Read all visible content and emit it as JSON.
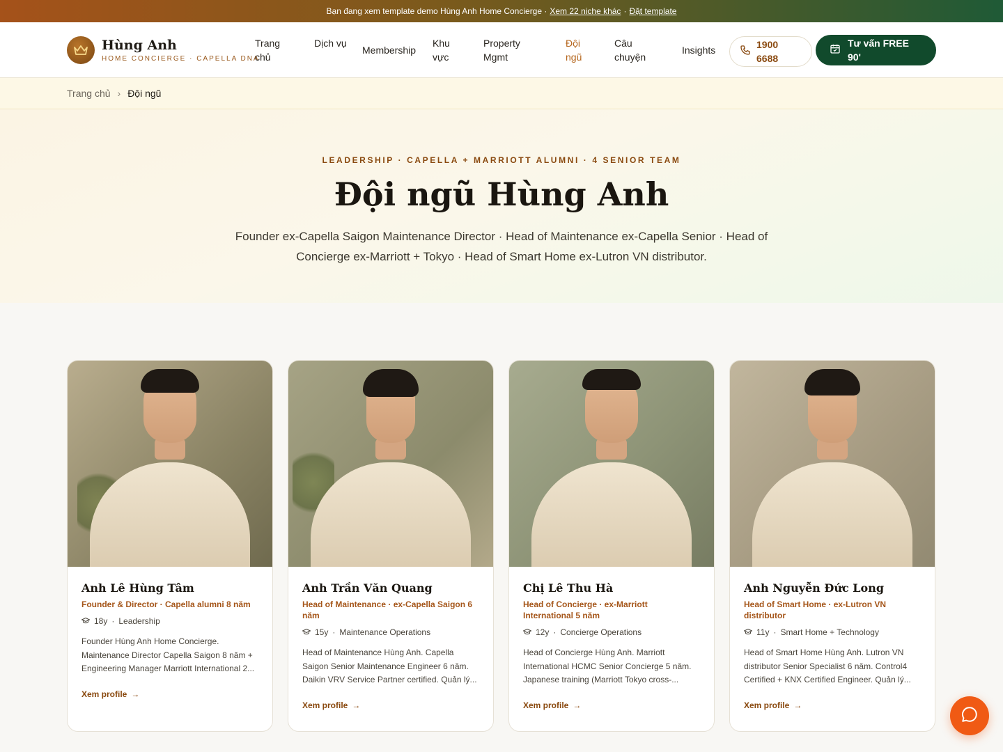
{
  "banner": {
    "text": "Bạn đang xem template demo Hùng Anh Home Concierge ·",
    "link_more": "Xem 22 niche khác",
    "separator": "·",
    "link_order": "Đặt template"
  },
  "header": {
    "logo_name": "Hùng Anh",
    "logo_tagline": "HOME CONCIERGE · CAPELLA DNA",
    "nav": [
      {
        "label": "Trang chủ"
      },
      {
        "label": "Dịch vụ"
      },
      {
        "label": "Membership"
      },
      {
        "label": "Khu vực"
      },
      {
        "label": "Property Mgmt"
      },
      {
        "label": "Đội ngũ",
        "active": true
      },
      {
        "label": "Câu chuyện"
      },
      {
        "label": "Insights"
      }
    ],
    "phone": "1900 6688",
    "cta": "Tư vấn FREE 90'"
  },
  "breadcrumb": {
    "home": "Trang chủ",
    "separator": "›",
    "current": "Đội ngũ"
  },
  "hero": {
    "eyebrow": "LEADERSHIP · CAPELLA + MARRIOTT ALUMNI · 4 SENIOR TEAM",
    "title": "Đội ngũ Hùng Anh",
    "subtitle": "Founder ex-Capella Saigon Maintenance Director · Head of Maintenance ex-Capella Senior · Head of Concierge ex-Marriott + Tokyo · Head of Smart Home ex-Lutron VN distributor."
  },
  "team": [
    {
      "name": "Anh Lê Hùng Tâm",
      "role": "Founder & Director · Capella alumni 8 năm",
      "years": "18y",
      "area": "Leadership",
      "desc": "Founder Hùng Anh Home Concierge. Maintenance Director Capella Saigon 8 năm + Engineering Manager Marriott International 2...",
      "link": "Xem profile"
    },
    {
      "name": "Anh Trần Văn Quang",
      "role": "Head of Maintenance · ex-Capella Saigon 6 năm",
      "years": "15y",
      "area": "Maintenance Operations",
      "desc": "Head of Maintenance Hùng Anh. Capella Saigon Senior Maintenance Engineer 6 năm. Daikin VRV Service Partner certified. Quản lý...",
      "link": "Xem profile"
    },
    {
      "name": "Chị Lê Thu Hà",
      "role": "Head of Concierge · ex-Marriott International 5 năm",
      "years": "12y",
      "area": "Concierge Operations",
      "desc": "Head of Concierge Hùng Anh. Marriott International HCMC Senior Concierge 5 năm. Japanese training (Marriott Tokyo cross-...",
      "link": "Xem profile"
    },
    {
      "name": "Anh Nguyễn Đức Long",
      "role": "Head of Smart Home · ex-Lutron VN distributor",
      "years": "11y",
      "area": "Smart Home + Technology",
      "desc": "Head of Smart Home Hùng Anh. Lutron VN distributor Senior Specialist 6 năm. Control4 Certified + KNX Certified Engineer. Quản lý...",
      "link": "Xem profile"
    }
  ],
  "meta_separator": "·",
  "link_arrow": "→",
  "colors": {
    "accent": "#a5561a",
    "cta_green": "#114a2c",
    "chat_orange": "#f05a14"
  }
}
